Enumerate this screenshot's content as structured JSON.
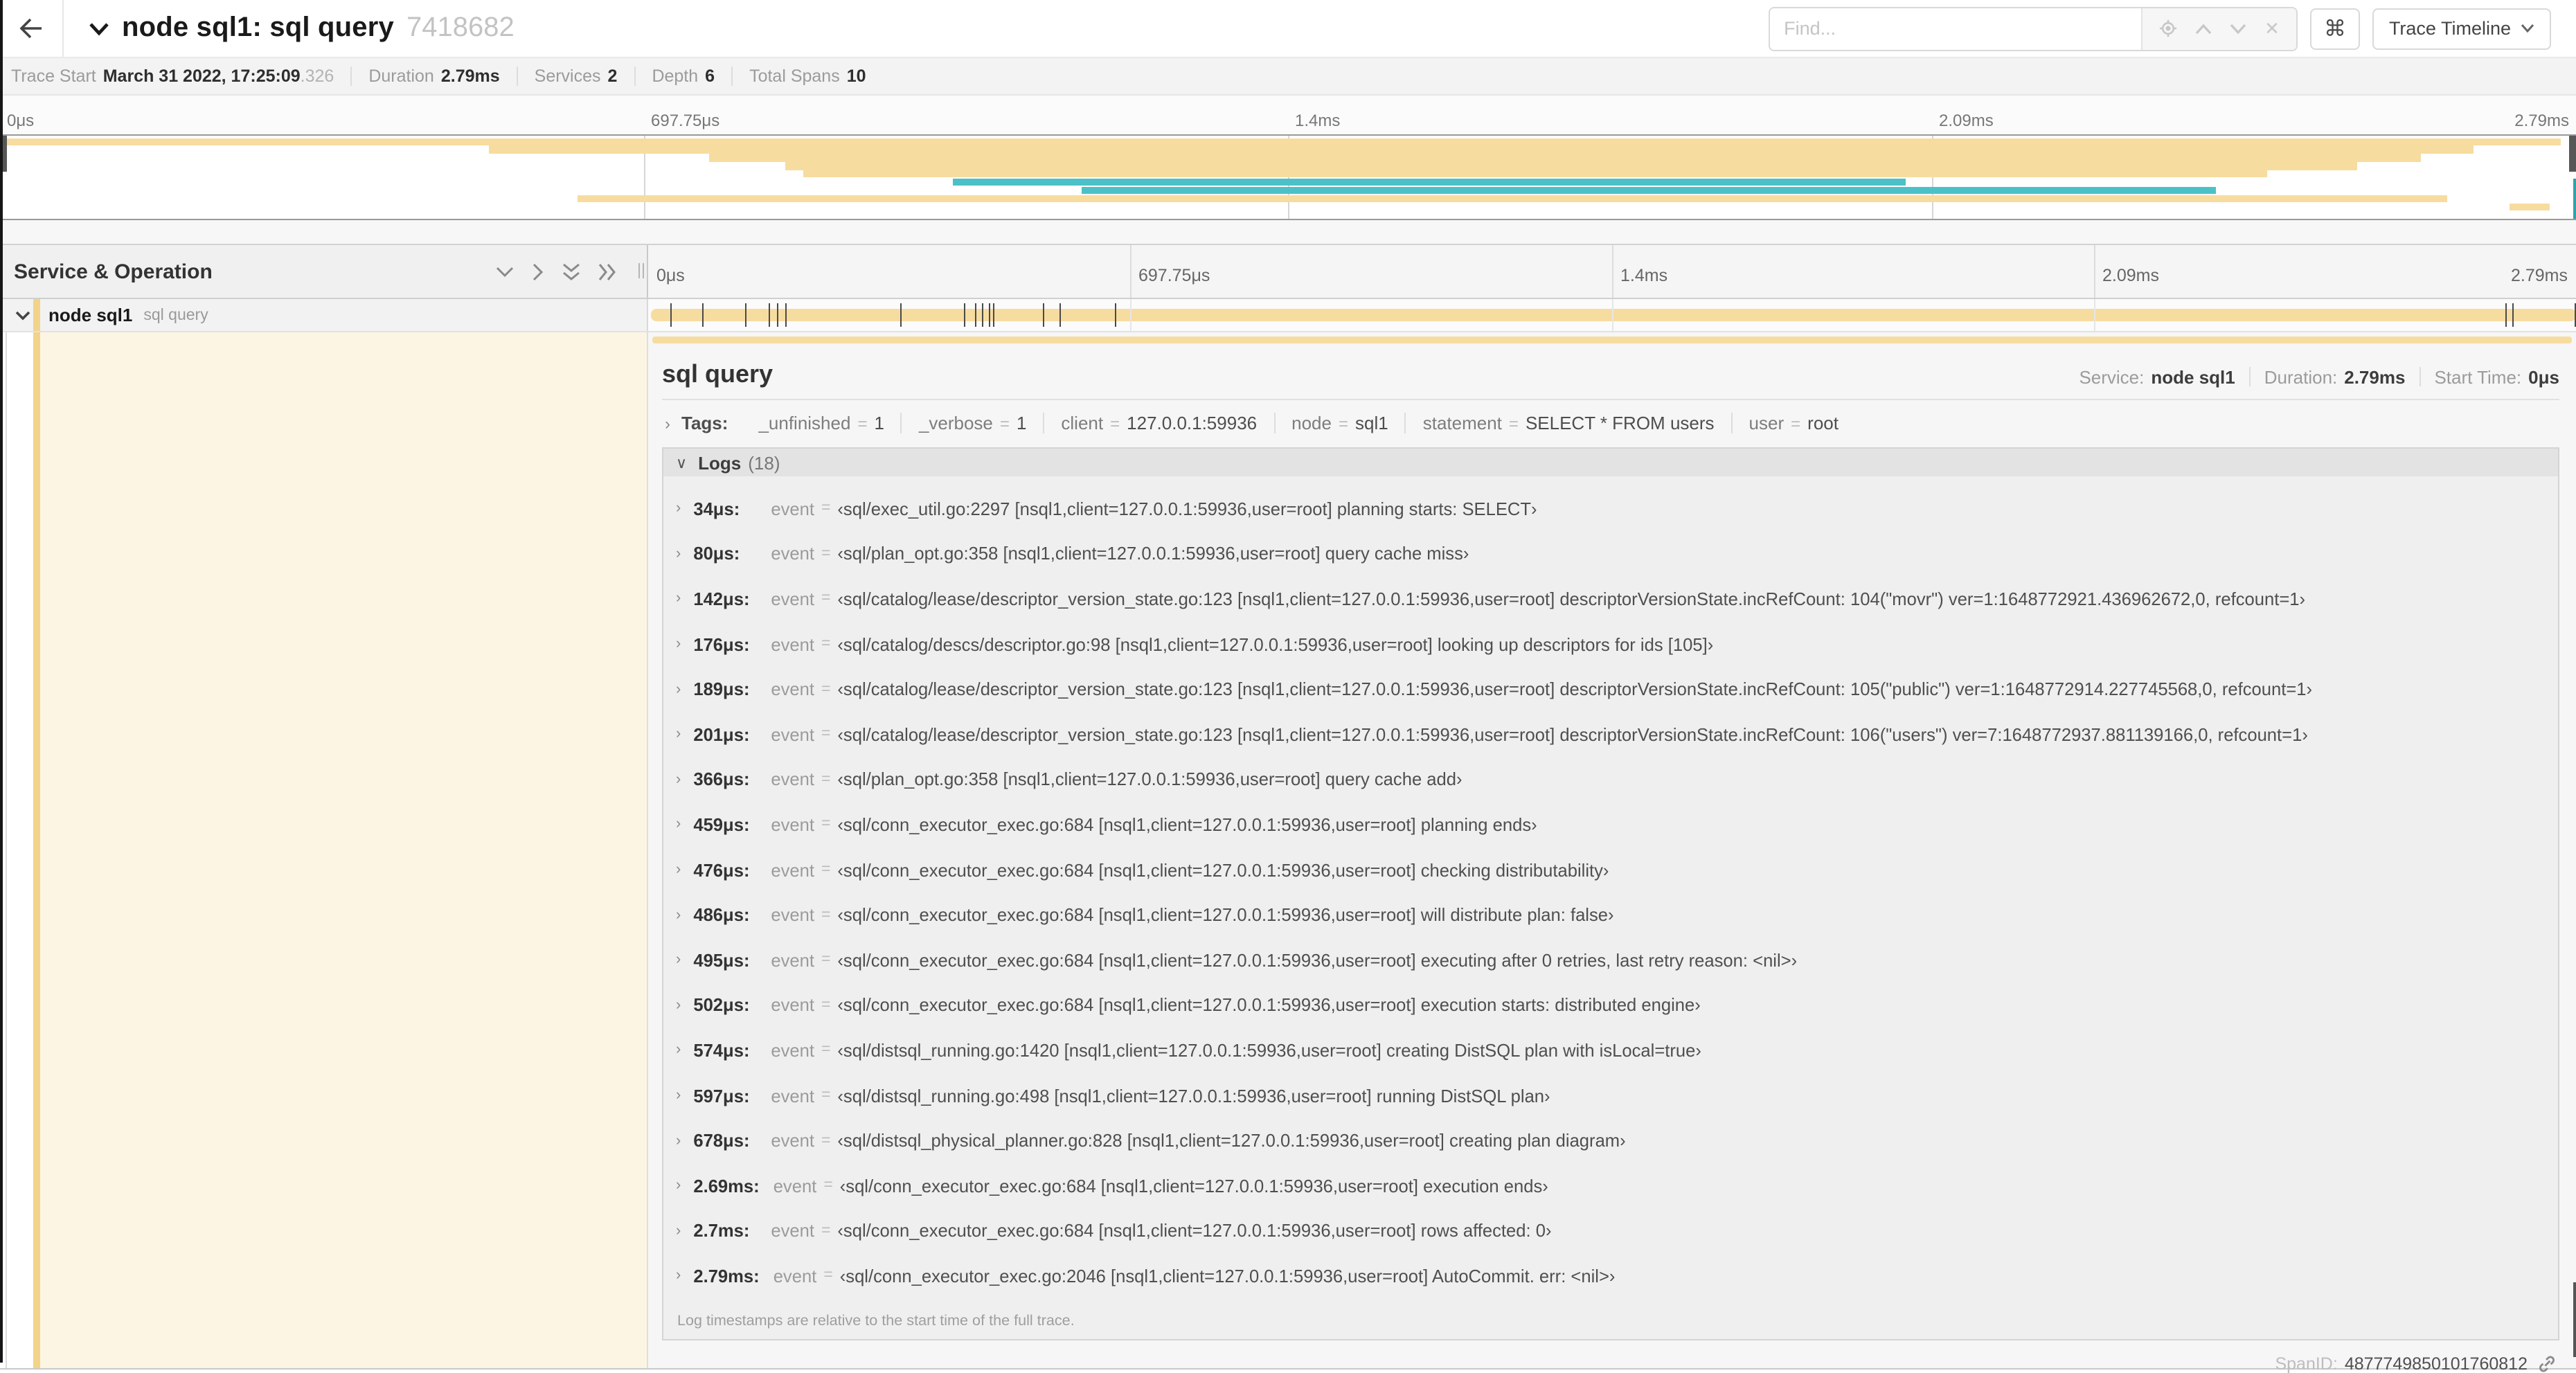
{
  "colors": {
    "tan": "#F7DCA0",
    "tan_strip": "#F2D389",
    "cream": "#FDF5E4",
    "teal": "#4BC1C7"
  },
  "header": {
    "title": "node sql1: sql query",
    "trace_id": "7418682",
    "find_placeholder": "Find...",
    "keyboard_shortcut_label": "⌘",
    "view_selector": "Trace Timeline",
    "find_clear_label": "✕"
  },
  "trace": {
    "total_us": 2790,
    "meta": [
      {
        "label": "Trace Start",
        "value": "March 31 2022, 17:25:09",
        "suffix": ".326"
      },
      {
        "label": "Duration",
        "value": "2.79ms",
        "suffix": ""
      },
      {
        "label": "Services",
        "value": "2",
        "suffix": ""
      },
      {
        "label": "Depth",
        "value": "6",
        "suffix": ""
      },
      {
        "label": "Total Spans",
        "value": "10",
        "suffix": ""
      }
    ]
  },
  "timeline": {
    "ticks": [
      {
        "label": "0μs",
        "pct": 0
      },
      {
        "label": "697.75μs",
        "pct": 25
      },
      {
        "label": "1.4ms",
        "pct": 50
      },
      {
        "label": "2.09ms",
        "pct": 75
      },
      {
        "label": "2.79ms",
        "pct": 100
      }
    ],
    "left_header": "Service & Operation"
  },
  "minimap": {
    "spans": [
      {
        "row": 0,
        "start_pct": 0,
        "end_pct": 99.4,
        "color": "tan"
      },
      {
        "row": 1,
        "start_pct": 19,
        "end_pct": 96,
        "color": "tan"
      },
      {
        "row": 2,
        "start_pct": 27.5,
        "end_pct": 94,
        "color": "tan"
      },
      {
        "row": 3,
        "start_pct": 30.5,
        "end_pct": 91.5,
        "color": "tan"
      },
      {
        "row": 4,
        "start_pct": 31.2,
        "end_pct": 88,
        "color": "tan"
      },
      {
        "row": 5,
        "start_pct": 37,
        "end_pct": 74,
        "color": "teal"
      },
      {
        "row": 6,
        "start_pct": 42,
        "end_pct": 86,
        "color": "teal"
      },
      {
        "row": 7,
        "start_pct": 22.4,
        "end_pct": 95,
        "color": "tan"
      },
      {
        "row": 8,
        "start_pct": 97.4,
        "end_pct": 99,
        "color": "tan"
      }
    ]
  },
  "row": {
    "service": "node sql1",
    "operation": "sql query",
    "bar_start_pct": 0.15,
    "bar_end_pct": 100,
    "log_marks_us": [
      34,
      80,
      142,
      176,
      189,
      201,
      366,
      459,
      476,
      486,
      495,
      502,
      574,
      597,
      678,
      2690,
      2700,
      2790
    ]
  },
  "detail": {
    "title": "sql query",
    "meta": [
      {
        "label": "Service:",
        "value": "node sql1"
      },
      {
        "label": "Duration:",
        "value": "2.79ms"
      },
      {
        "label": "Start Time:",
        "value": "0μs"
      }
    ],
    "tags_label": "Tags:",
    "tags": [
      {
        "key": "_unfinished",
        "value": "1"
      },
      {
        "key": "_verbose",
        "value": "1"
      },
      {
        "key": "client",
        "value": "127.0.0.1:59936"
      },
      {
        "key": "node",
        "value": "sql1"
      },
      {
        "key": "statement",
        "value": "SELECT * FROM users"
      },
      {
        "key": "user",
        "value": "root"
      }
    ],
    "logs_label": "Logs",
    "logs_count": "(18)",
    "logs": [
      {
        "t": "34μs:",
        "k": "event",
        "v": "‹sql/exec_util.go:2297 [nsql1,client=127.0.0.1:59936,user=root] planning starts: SELECT›"
      },
      {
        "t": "80μs:",
        "k": "event",
        "v": "‹sql/plan_opt.go:358 [nsql1,client=127.0.0.1:59936,user=root] query cache miss›"
      },
      {
        "t": "142μs:",
        "k": "event",
        "v": "‹sql/catalog/lease/descriptor_version_state.go:123 [nsql1,client=127.0.0.1:59936,user=root] descriptorVersionState.incRefCount: 104(\"movr\") ver=1:1648772921.436962672,0, refcount=1›"
      },
      {
        "t": "176μs:",
        "k": "event",
        "v": "‹sql/catalog/descs/descriptor.go:98 [nsql1,client=127.0.0.1:59936,user=root] looking up descriptors for ids [105]›"
      },
      {
        "t": "189μs:",
        "k": "event",
        "v": "‹sql/catalog/lease/descriptor_version_state.go:123 [nsql1,client=127.0.0.1:59936,user=root] descriptorVersionState.incRefCount: 105(\"public\") ver=1:1648772914.227745568,0, refcount=1›"
      },
      {
        "t": "201μs:",
        "k": "event",
        "v": "‹sql/catalog/lease/descriptor_version_state.go:123 [nsql1,client=127.0.0.1:59936,user=root] descriptorVersionState.incRefCount: 106(\"users\") ver=7:1648772937.881139166,0, refcount=1›"
      },
      {
        "t": "366μs:",
        "k": "event",
        "v": "‹sql/plan_opt.go:358 [nsql1,client=127.0.0.1:59936,user=root] query cache add›"
      },
      {
        "t": "459μs:",
        "k": "event",
        "v": "‹sql/conn_executor_exec.go:684 [nsql1,client=127.0.0.1:59936,user=root] planning ends›"
      },
      {
        "t": "476μs:",
        "k": "event",
        "v": "‹sql/conn_executor_exec.go:684 [nsql1,client=127.0.0.1:59936,user=root] checking distributability›"
      },
      {
        "t": "486μs:",
        "k": "event",
        "v": "‹sql/conn_executor_exec.go:684 [nsql1,client=127.0.0.1:59936,user=root] will distribute plan: false›"
      },
      {
        "t": "495μs:",
        "k": "event",
        "v": "‹sql/conn_executor_exec.go:684 [nsql1,client=127.0.0.1:59936,user=root] executing after 0 retries, last retry reason: <nil>›"
      },
      {
        "t": "502μs:",
        "k": "event",
        "v": "‹sql/conn_executor_exec.go:684 [nsql1,client=127.0.0.1:59936,user=root] execution starts: distributed engine›"
      },
      {
        "t": "574μs:",
        "k": "event",
        "v": "‹sql/distsql_running.go:1420 [nsql1,client=127.0.0.1:59936,user=root] creating DistSQL plan with isLocal=true›"
      },
      {
        "t": "597μs:",
        "k": "event",
        "v": "‹sql/distsql_running.go:498 [nsql1,client=127.0.0.1:59936,user=root] running DistSQL plan›"
      },
      {
        "t": "678μs:",
        "k": "event",
        "v": "‹sql/distsql_physical_planner.go:828 [nsql1,client=127.0.0.1:59936,user=root] creating plan diagram›"
      },
      {
        "t": "2.69ms:",
        "k": "event",
        "v": "‹sql/conn_executor_exec.go:684 [nsql1,client=127.0.0.1:59936,user=root] execution ends›"
      },
      {
        "t": "2.7ms:",
        "k": "event",
        "v": "‹sql/conn_executor_exec.go:684 [nsql1,client=127.0.0.1:59936,user=root] rows affected: 0›"
      },
      {
        "t": "2.79ms:",
        "k": "event",
        "v": "‹sql/conn_executor_exec.go:2046 [nsql1,client=127.0.0.1:59936,user=root] AutoCommit. err: <nil>›"
      }
    ],
    "logs_footnote": "Log timestamps are relative to the start time of the full trace.",
    "span_id_label": "SpanID:",
    "span_id": "4877749850101760812"
  }
}
